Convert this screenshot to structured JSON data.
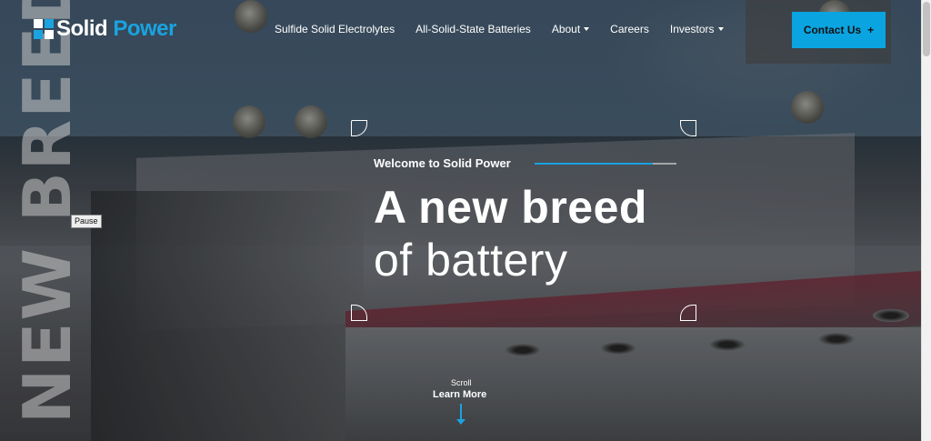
{
  "logo": {
    "word_solid": "Solid",
    "word_power": "Power",
    "mark_colors": [
      "#ffffff",
      "#1aa3e0"
    ]
  },
  "nav": {
    "items": [
      {
        "label": "Sulfide Solid Electrolytes",
        "dropdown": false
      },
      {
        "label": "All-Solid-State Batteries",
        "dropdown": false
      },
      {
        "label": "About",
        "dropdown": true
      },
      {
        "label": "Careers",
        "dropdown": false
      },
      {
        "label": "Investors",
        "dropdown": true
      }
    ],
    "contact_label": "Contact Us",
    "contact_icon": "+"
  },
  "hero": {
    "vertical_word": "NEW BREED",
    "pause_label": "Pause",
    "welcome": "Welcome to Solid Power",
    "headline_bold": "A new breed",
    "headline_light": "of battery",
    "scroll_label": "Scroll",
    "learn_more": "Learn More"
  },
  "colors": {
    "accent": "#1aa3e0",
    "contact_button": "#0aa4e1"
  }
}
